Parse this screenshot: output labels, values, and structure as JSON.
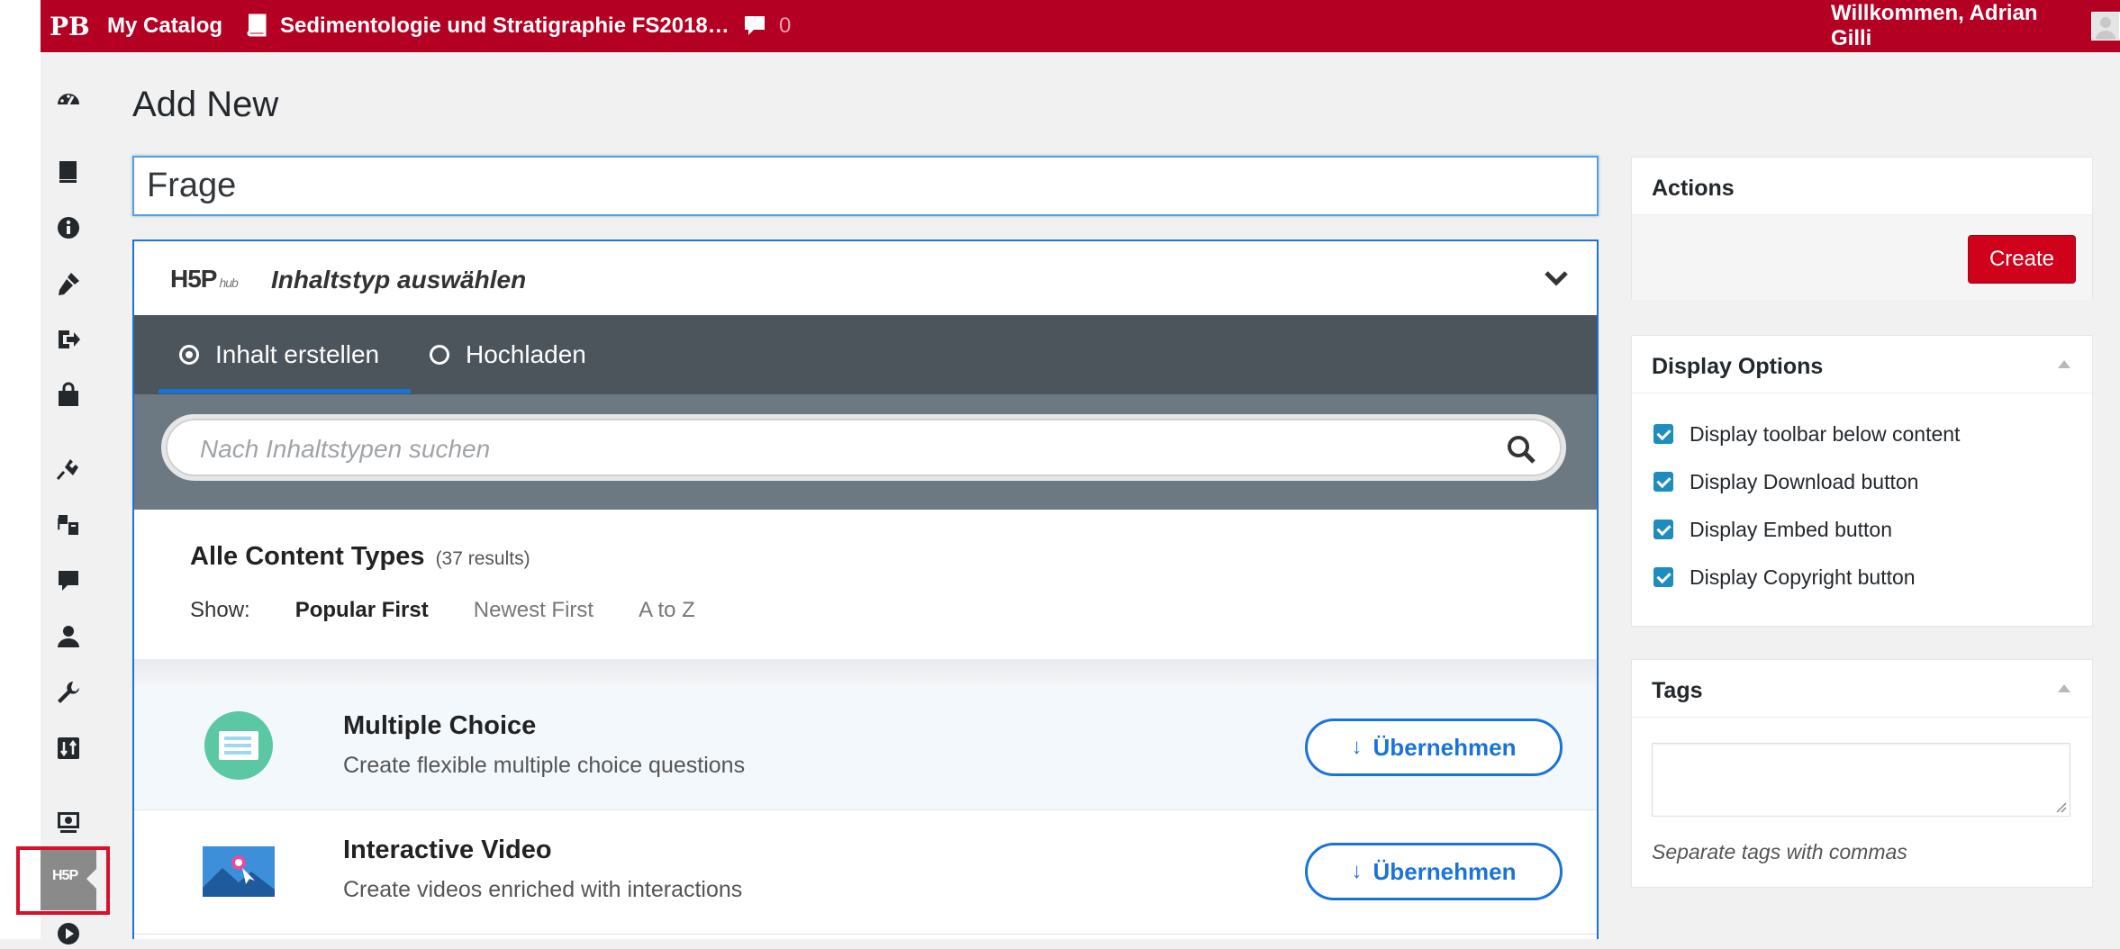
{
  "adminbar": {
    "logo": "PB",
    "my_catalog": "My Catalog",
    "book_title": "Sedimentologie und Stratigraphie FS2018…",
    "comments_count": "0",
    "welcome": "Willkommen, Adrian Gilli"
  },
  "sidebar": {
    "items": [
      {
        "icon": "dashboard-icon"
      },
      {
        "icon": "book-icon"
      },
      {
        "icon": "info-icon"
      },
      {
        "icon": "appearance-icon"
      },
      {
        "icon": "export-icon"
      },
      {
        "icon": "store-icon"
      },
      {
        "icon": "plugins-icon"
      },
      {
        "icon": "translation-icon"
      },
      {
        "icon": "comments-icon"
      },
      {
        "icon": "users-icon"
      },
      {
        "icon": "tools-icon"
      },
      {
        "icon": "import-icon"
      },
      {
        "icon": "media-icon"
      },
      {
        "icon": "h5p-icon",
        "label": "H5P"
      },
      {
        "icon": "play-icon"
      }
    ]
  },
  "page": {
    "title": "Add New",
    "title_value": "Frage"
  },
  "hub": {
    "logo_text": "H5P",
    "logo_sub": "hub",
    "select_title": "Inhaltstyp auswählen",
    "tabs": [
      {
        "label": "Inhalt erstellen",
        "selected": true
      },
      {
        "label": "Hochladen",
        "selected": false
      }
    ],
    "search_placeholder": "Nach Inhaltstypen suchen",
    "list_title": "Alle Content Types",
    "list_count": "(37 results)",
    "show_label": "Show:",
    "sort_options": [
      "Popular First",
      "Newest First",
      "A to Z"
    ],
    "content_types": [
      {
        "name": "Multiple Choice",
        "description": "Create flexible multiple choice questions",
        "button": "Übernehmen"
      },
      {
        "name": "Interactive Video",
        "description": "Create videos enriched with interactions",
        "button": "Übernehmen"
      }
    ]
  },
  "actions_box": {
    "title": "Actions",
    "create_label": "Create"
  },
  "display_options": {
    "title": "Display Options",
    "options": [
      {
        "label": "Display toolbar below content",
        "checked": true
      },
      {
        "label": "Display Download button",
        "checked": true
      },
      {
        "label": "Display Embed button",
        "checked": true
      },
      {
        "label": "Display Copyright button",
        "checked": true
      }
    ]
  },
  "tags_box": {
    "title": "Tags",
    "help": "Separate tags with commas"
  },
  "colors": {
    "adminbar": "#b40023",
    "accent_blue": "#1a73d9",
    "create_button": "#d0021b",
    "highlight_box": "#d8102c"
  }
}
